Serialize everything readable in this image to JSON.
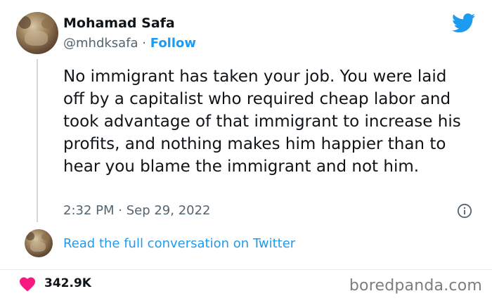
{
  "author": {
    "name": "Mohamad Safa",
    "handle": "@mhdksafa",
    "separator": " · ",
    "follow_label": "Follow"
  },
  "tweet": {
    "text": "No immigrant has taken your job. You were laid off by a capitalist who required cheap labor and took advantage of that immigrant to increase his profits, and nothing makes him happier than to hear you blame the immigrant and not him.",
    "timestamp": "2:32 PM · Sep 29, 2022"
  },
  "conversation_link": "Read the full conversation on Twitter",
  "likes": "342.9K",
  "watermark": "boredpanda.com",
  "icons": {
    "brand": "twitter-bird-icon",
    "info": "info-icon",
    "like": "heart-icon"
  },
  "colors": {
    "accent": "#1d9bf0",
    "text": "#0f1419",
    "muted": "#536471",
    "heart": "#f91880"
  }
}
